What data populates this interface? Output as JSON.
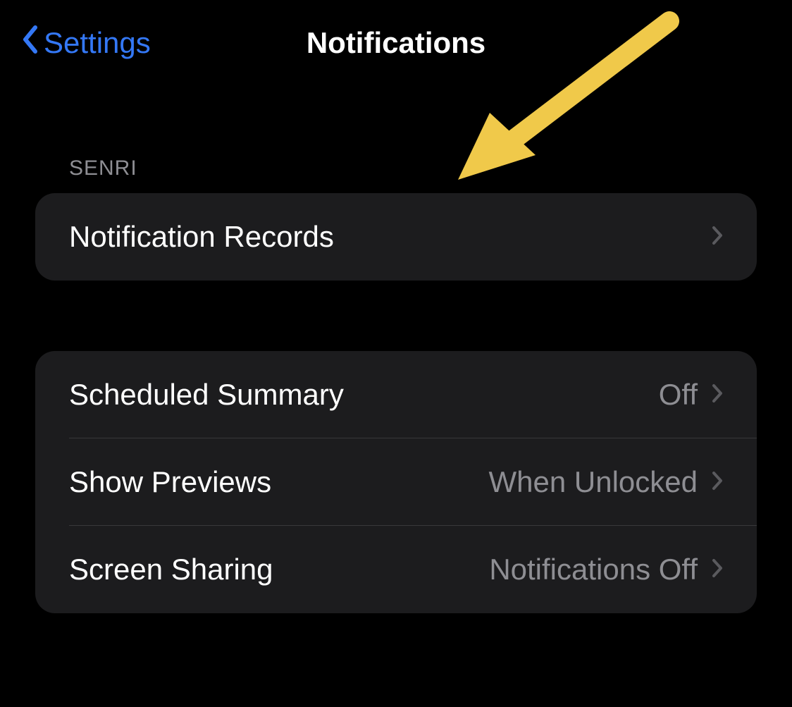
{
  "header": {
    "back_label": "Settings",
    "title": "Notifications"
  },
  "section1": {
    "header": "SENRI",
    "items": [
      {
        "label": "Notification Records"
      }
    ]
  },
  "section2": {
    "items": [
      {
        "label": "Scheduled Summary",
        "value": "Off"
      },
      {
        "label": "Show Previews",
        "value": "When Unlocked"
      },
      {
        "label": "Screen Sharing",
        "value": "Notifications Off"
      }
    ]
  }
}
